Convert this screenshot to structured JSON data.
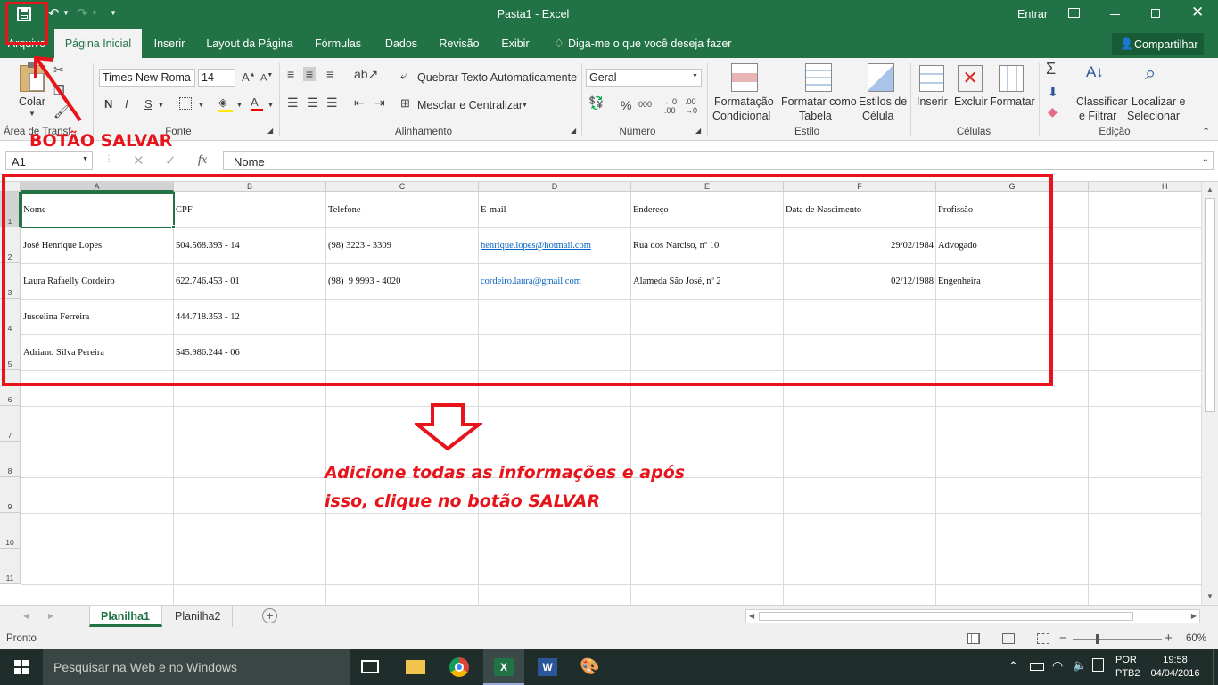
{
  "window": {
    "title": "Pasta1 - Excel",
    "signin": "Entrar"
  },
  "tabs": [
    {
      "label": "Arquivo"
    },
    {
      "label": "Página Inicial"
    },
    {
      "label": "Inserir"
    },
    {
      "label": "Layout da Página"
    },
    {
      "label": "Fórmulas"
    },
    {
      "label": "Dados"
    },
    {
      "label": "Revisão"
    },
    {
      "label": "Exibir"
    }
  ],
  "tellme": "Diga-me o que você deseja fazer",
  "share": "Compartilhar",
  "ribbon": {
    "clipboard": {
      "paste": "Colar",
      "label": "Área de Transf..."
    },
    "font": {
      "name": "Times New Roma",
      "size": "14",
      "bold": "N",
      "italic": "I",
      "underline": "S",
      "label": "Fonte"
    },
    "align": {
      "wrap": "Quebrar Texto Automaticamente",
      "merge": "Mesclar e Centralizar",
      "label": "Alinhamento"
    },
    "number": {
      "format": "Geral",
      "label": "Número",
      "percent": "%",
      "thousands": "000"
    },
    "styles": {
      "cond1": "Formatação",
      "cond2": "Condicional",
      "table1": "Formatar como",
      "table2": "Tabela",
      "cell1": "Estilos de",
      "cell2": "Célula",
      "label": "Estilo"
    },
    "cells": {
      "insert": "Inserir",
      "delete": "Excluir",
      "format": "Formatar",
      "label": "Células"
    },
    "edit": {
      "sort1": "Classificar",
      "sort2": "e Filtrar",
      "find1": "Localizar e",
      "find2": "Selecionar",
      "label": "Edição"
    }
  },
  "formula": {
    "namebox": "A1",
    "content": "Nome",
    "fx": "fx"
  },
  "columns": [
    "A",
    "B",
    "C",
    "D",
    "E",
    "F",
    "G",
    "H"
  ],
  "rows": [
    "1",
    "2",
    "3",
    "4",
    "5",
    "6",
    "7",
    "8",
    "9",
    "10",
    "11"
  ],
  "table": {
    "header": [
      "Nome",
      "CPF",
      "Telefone",
      "E-mail",
      "Endereço",
      "Data de Nascimento",
      "Profissão"
    ],
    "rows": [
      [
        "José Henrique Lopes",
        "504.568.393 - 14",
        "(98) 3223 - 3309",
        "henrique.lopes@hotmail.com",
        "Rua dos Narciso, nº 10",
        "29/02/1984",
        "Advogado"
      ],
      [
        "Laura Rafaelly Cordeiro",
        "622.746.453 - 01",
        "(98)  9 9993 - 4020",
        "cordeiro.laura@gmail.com",
        "Alameda São José, nº 2",
        "02/12/1988",
        "Engenheira"
      ],
      [
        "Juscelina Ferreira",
        "444.718.353 - 12",
        "",
        "",
        "",
        "",
        ""
      ],
      [
        "Adriano Silva Pereira",
        "545.986.244 - 06",
        "",
        "",
        "",
        "",
        ""
      ]
    ]
  },
  "sheets": [
    "Planilha1",
    "Planilha2"
  ],
  "status": {
    "ready": "Pronto",
    "zoom": "60%"
  },
  "taskbar": {
    "search": "Pesquisar na Web e no Windows",
    "lang1": "POR",
    "lang2": "PTB2",
    "time": "19:58",
    "date": "04/04/2016"
  },
  "annotations": {
    "save_label": "BOTÃO SALVAR",
    "instruction1": "Adicione todas as informações e após",
    "instruction2": "isso, clique no botão SALVAR"
  },
  "colors": {
    "excel_green": "#217346",
    "annotation_red": "#e8141b"
  }
}
